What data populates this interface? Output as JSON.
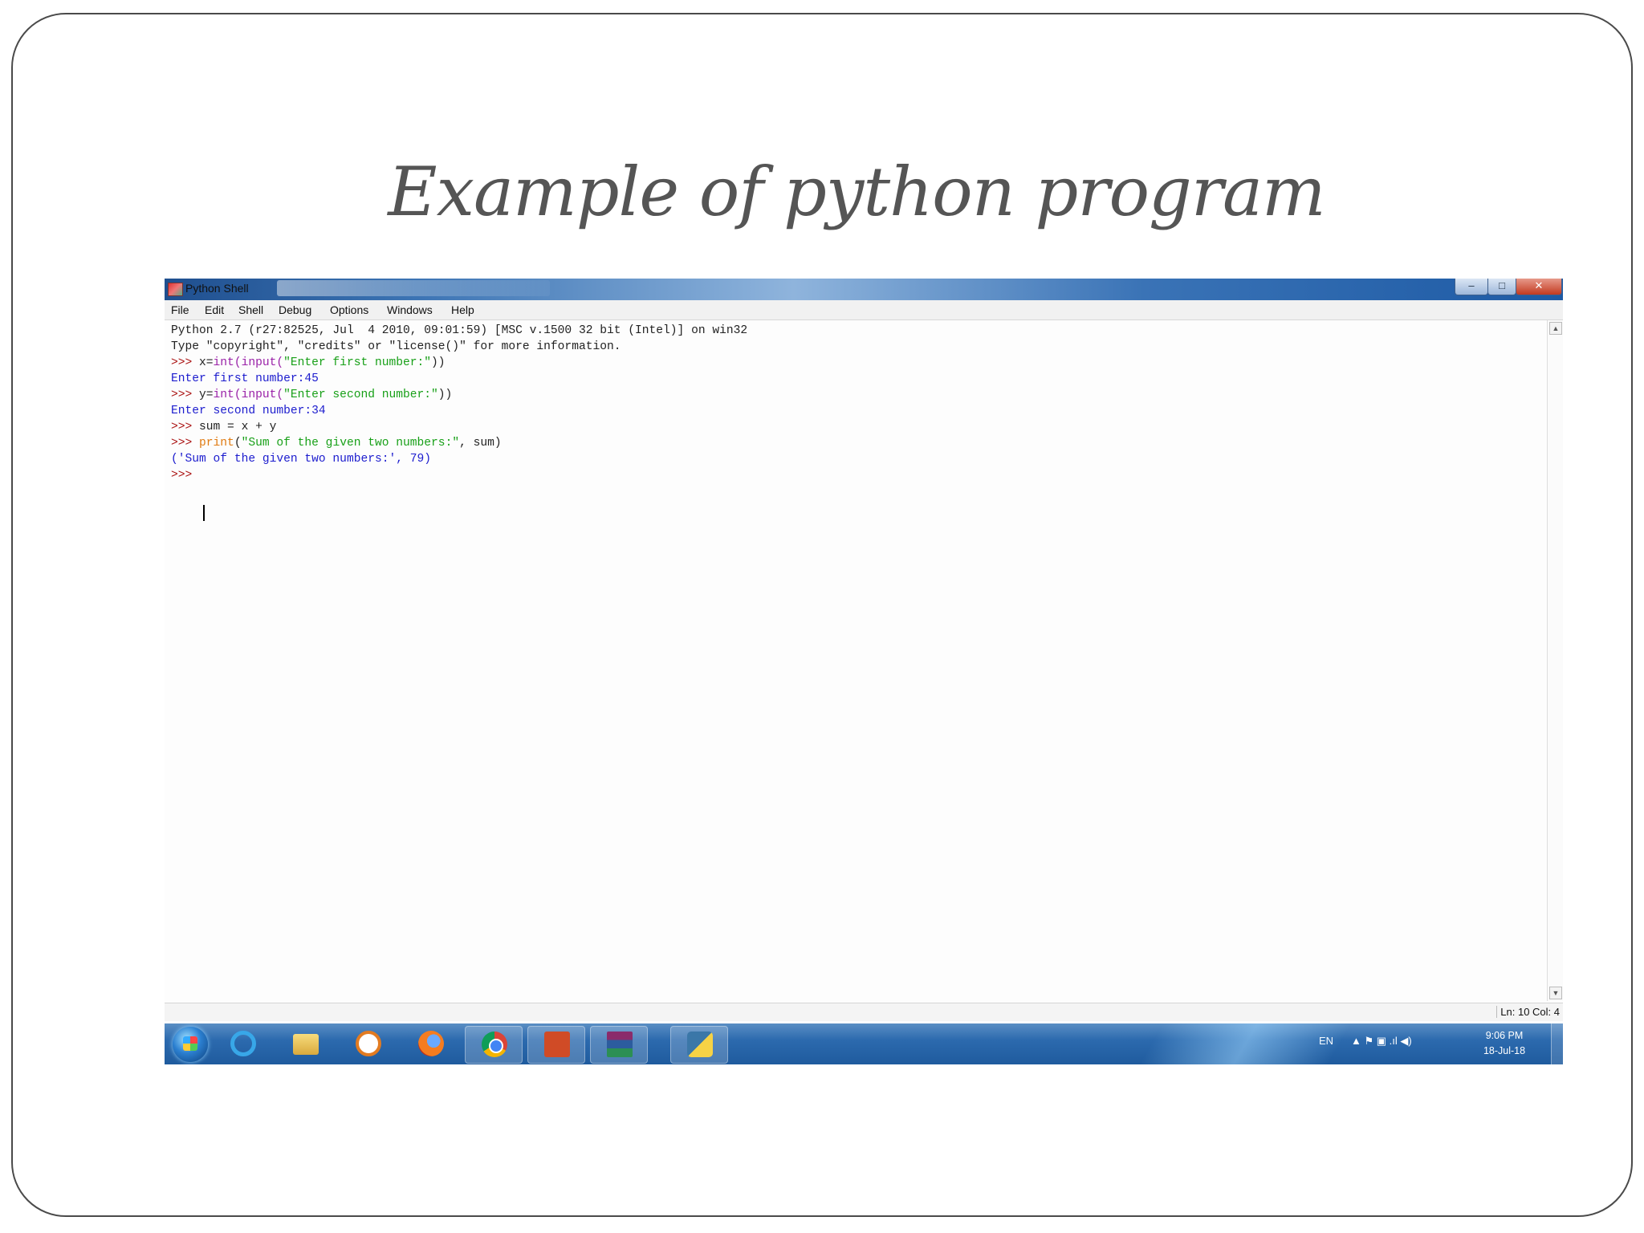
{
  "slide": {
    "title": "Example of python program"
  },
  "window": {
    "title": "Python Shell",
    "controls": {
      "minimize": "–",
      "maximize": "□",
      "close": "✕"
    }
  },
  "menu": [
    "File",
    "Edit",
    "Shell",
    "Debug",
    "Options",
    "Windows",
    "Help"
  ],
  "shell": {
    "banner_line1": "Python 2.7 (r27:82525, Jul  4 2010, 09:01:59) [MSC v.1500 32 bit (Intel)] on win32",
    "banner_line2": "Type \"copyright\", \"credits\" or \"license()\" for more information.",
    "prompt": ">>> ",
    "cmd1_var": "x=",
    "cmd1_fn": "int(input(",
    "cmd1_str": "\"Enter first number:\"",
    "cmd1_end": "))",
    "out1": "Enter first number:45",
    "cmd2_var": "y=",
    "cmd2_fn": "int(input(",
    "cmd2_str": "\"Enter second number:\"",
    "cmd2_end": "))",
    "out2": "Enter second number:34",
    "cmd3": "sum = x + y",
    "cmd4_fn": "print",
    "cmd4_open": "(",
    "cmd4_str": "\"Sum of the given two numbers:\"",
    "cmd4_rest": ", sum)",
    "out3": "('Sum of the given two numbers:', 79)",
    "last_prompt": ">>> "
  },
  "statusbar": {
    "position": "Ln: 10 Col: 4"
  },
  "taskbar": {
    "apps": [
      "start-orb",
      "internet-explorer-icon",
      "folder-icon",
      "media-player-icon",
      "firefox-icon",
      "chrome-icon",
      "powerpoint-icon",
      "winrar-icon",
      "python-idle-icon"
    ],
    "language": "EN",
    "tray_glyphs": "▲  ⚑  ▣  .ıl  ◀)",
    "time": "9:06 PM",
    "date": "18-Jul-18"
  }
}
